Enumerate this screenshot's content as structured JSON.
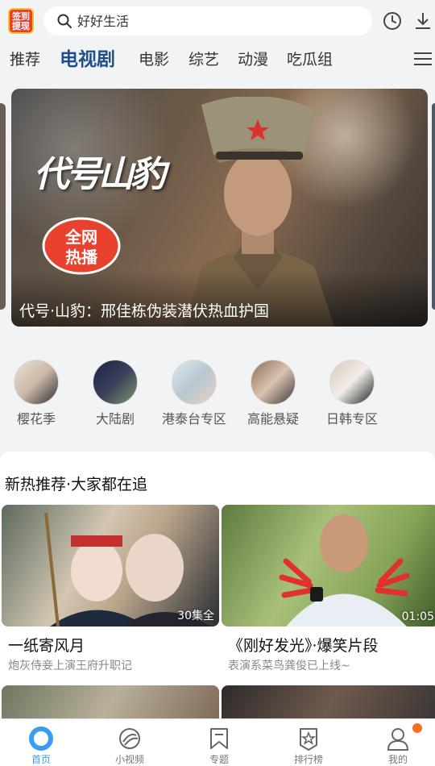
{
  "header": {
    "signin_badge_line1": "签到",
    "signin_badge_line2": "提现",
    "search_placeholder": "好好生活",
    "icons": [
      "search-icon",
      "history-icon",
      "download-icon"
    ]
  },
  "tabs": [
    {
      "label": "推荐",
      "active": false
    },
    {
      "label": "电视剧",
      "active": true
    },
    {
      "label": "电影",
      "active": false
    },
    {
      "label": "综艺",
      "active": false
    },
    {
      "label": "动漫",
      "active": false
    },
    {
      "label": "吃瓜组",
      "active": false
    }
  ],
  "banner": {
    "logo_text": "代号山豹",
    "badge_line1": "全网",
    "badge_line2": "热播",
    "caption": "代号·山豹：邢佳栋伪装潜伏热血护国"
  },
  "categories": [
    {
      "label": "樱花季"
    },
    {
      "label": "大陆剧"
    },
    {
      "label": "港泰台专区"
    },
    {
      "label": "高能悬疑"
    },
    {
      "label": "日韩专区"
    }
  ],
  "section": {
    "title": "新热推荐·大家都在追"
  },
  "cards": [
    {
      "title": "一纸寄风月",
      "subtitle": "炮灰侍妾上演王府升职记",
      "badge": "30集全"
    },
    {
      "title": "《刚好发光》·爆笑片段",
      "subtitle": "表演系菜鸟龚俊已上线~",
      "badge": "01:05"
    }
  ],
  "bottom_nav": [
    {
      "label": "首页",
      "icon": "home-icon",
      "active": true
    },
    {
      "label": "小视频",
      "icon": "short-video-icon",
      "active": false
    },
    {
      "label": "专题",
      "icon": "topic-icon",
      "active": false
    },
    {
      "label": "排行榜",
      "icon": "ranking-icon",
      "active": false
    },
    {
      "label": "我的",
      "icon": "profile-icon",
      "active": false
    }
  ],
  "colors": {
    "accent": "#3b9cf2",
    "active_tab": "#1e4f8a",
    "notification_dot": "#f36f21",
    "badge_red": "#e8412e"
  }
}
